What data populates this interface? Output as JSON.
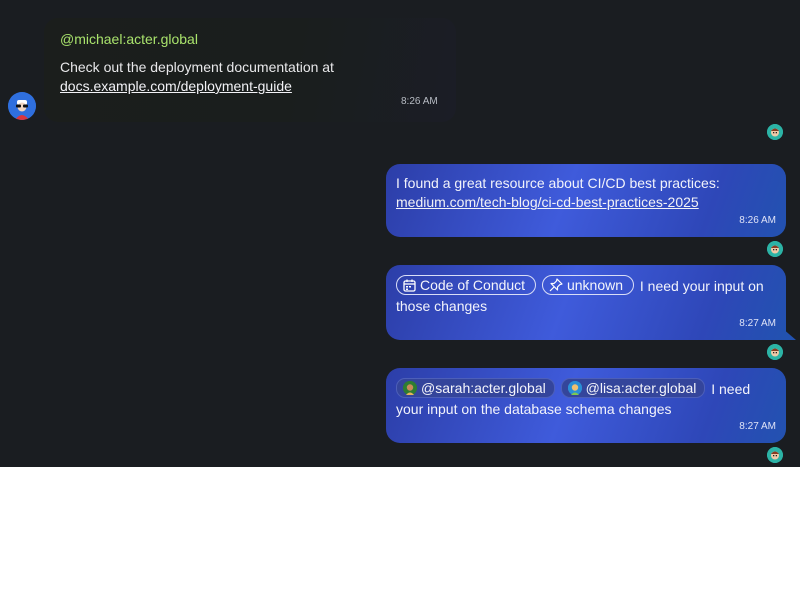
{
  "incoming": {
    "sender": "@michael:acter.global",
    "text": "Check out the deployment documentation at",
    "link": "docs.example.com/deployment-guide",
    "time": "8:26 AM"
  },
  "outgoing": [
    {
      "text": "I found a great resource about CI/CD best practices:",
      "link": "medium.com/tech-blog/ci-cd-best-practices-2025",
      "time": "8:26 AM"
    },
    {
      "pill_1": "Code of Conduct",
      "pill_1_icon": "calendar-icon",
      "pill_2": "unknown",
      "pill_2_icon": "pin-icon",
      "text": "I need your input on those changes",
      "time": "8:27 AM"
    },
    {
      "mention_1": "@sarah:acter.global",
      "mention_2": "@lisa:acter.global",
      "text": "I need your input on the database schema changes",
      "time": "8:27 AM"
    }
  ],
  "colors": {
    "chat_background": "#1a1d21",
    "sender_name": "#a9e36c",
    "bubble_blue": "#3f5bdb",
    "page_background": "#ffffff"
  }
}
